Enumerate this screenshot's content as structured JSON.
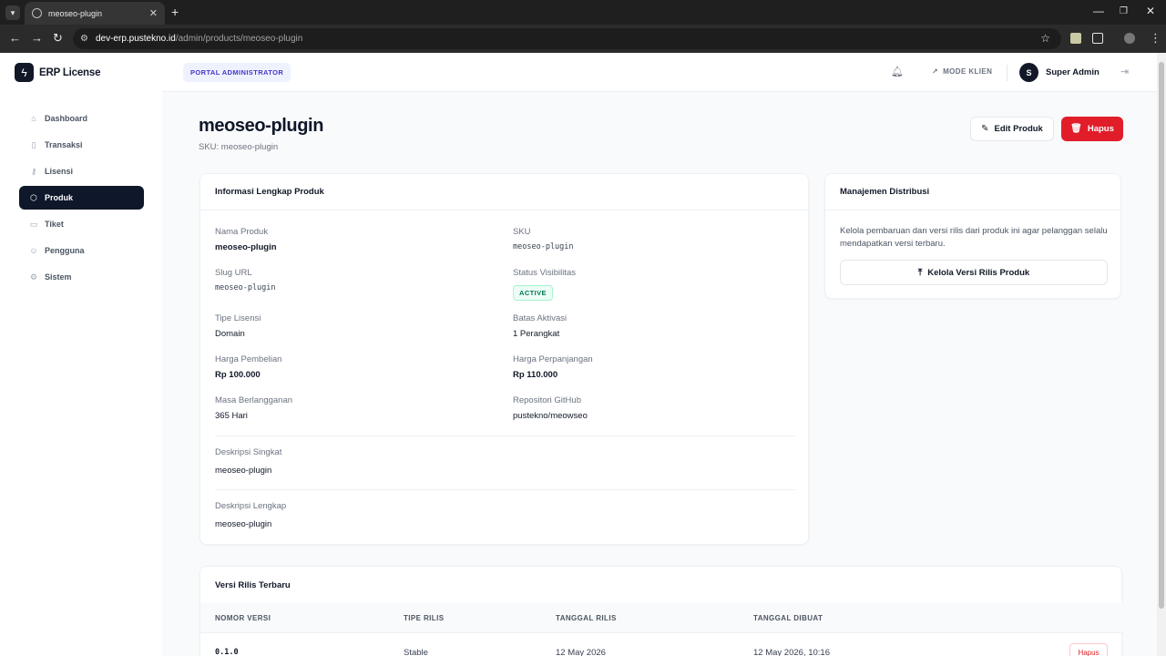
{
  "browser": {
    "tab_title": "meoseo-plugin",
    "url_host": "dev-erp.pustekno.id",
    "url_path": "/admin/products/meoseo-plugin"
  },
  "brand": {
    "name": "ERP License"
  },
  "header": {
    "portal_badge": "PORTAL ADMINISTRATOR",
    "mode_klien": "MODE KLIEN",
    "avatar_initial": "S",
    "user_name": "Super Admin"
  },
  "sidebar": {
    "items": [
      {
        "label": "Dashboard",
        "icon": "home-icon"
      },
      {
        "label": "Transaksi",
        "icon": "receipt-icon"
      },
      {
        "label": "Lisensi",
        "icon": "key-icon"
      },
      {
        "label": "Produk",
        "icon": "box-icon",
        "active": true
      },
      {
        "label": "Tiket",
        "icon": "ticket-icon"
      },
      {
        "label": "Pengguna",
        "icon": "users-icon"
      },
      {
        "label": "Sistem",
        "icon": "gear-icon"
      }
    ]
  },
  "page": {
    "title": "meoseo-plugin",
    "sku_line": "SKU: meoseo-plugin",
    "edit_label": "Edit Produk",
    "delete_label": "Hapus"
  },
  "info_card": {
    "title": "Informasi Lengkap Produk",
    "fields": {
      "nama_label": "Nama Produk",
      "nama_value": "meoseo-plugin",
      "sku_label": "SKU",
      "sku_value": "meoseo-plugin",
      "slug_label": "Slug URL",
      "slug_value": "meoseo-plugin",
      "status_label": "Status Visibilitas",
      "status_value": "ACTIVE",
      "tipe_label": "Tipe Lisensi",
      "tipe_value": "Domain",
      "batas_label": "Batas Aktivasi",
      "batas_value": "1 Perangkat",
      "harga_label": "Harga Pembelian",
      "harga_value": "Rp 100.000",
      "perpanjangan_label": "Harga Perpanjangan",
      "perpanjangan_value": "Rp 110.000",
      "masa_label": "Masa Berlangganan",
      "masa_value": "365 Hari",
      "repo_label": "Repositori GitHub",
      "repo_value": "pustekno/meowseo",
      "desk_singkat_label": "Deskripsi Singkat",
      "desk_singkat_value": "meoseo-plugin",
      "desk_lengkap_label": "Deskripsi Lengkap",
      "desk_lengkap_value": "meoseo-plugin"
    }
  },
  "dist_card": {
    "title": "Manajemen Distribusi",
    "text": "Kelola pembaruan dan versi rilis dari produk ini agar pelanggan selalu mendapatkan versi terbaru.",
    "button_label": "Kelola Versi Rilis Produk"
  },
  "releases": {
    "title": "Versi Rilis Terbaru",
    "columns": [
      "NOMOR VERSI",
      "TIPE RILIS",
      "TANGGAL RILIS",
      "TANGGAL DIBUAT"
    ],
    "rows": [
      {
        "version": "0.1.0",
        "type": "Stable",
        "release_date": "12 May 2026",
        "created": "12 May 2026, 10:16",
        "action": "Hapus"
      }
    ]
  },
  "colors": {
    "primary_dark": "#0f172a",
    "danger": "#e11d2a",
    "success": "#047857",
    "accent": "#4338ca"
  }
}
